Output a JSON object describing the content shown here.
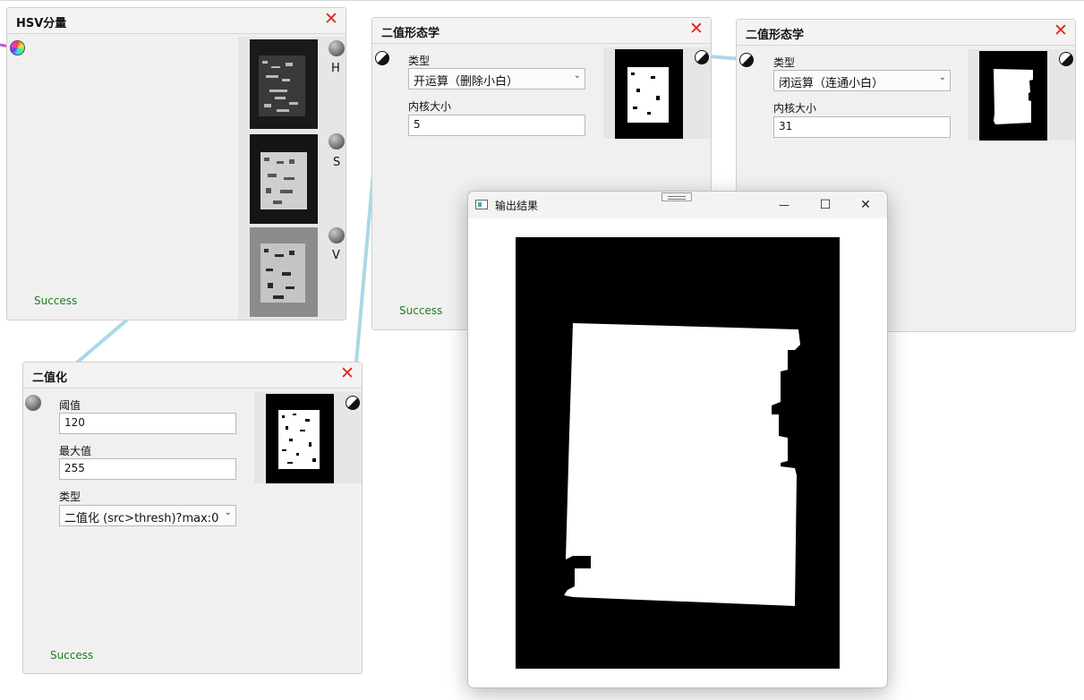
{
  "nodes": {
    "hsv": {
      "title": "HSV分量",
      "channels": [
        "H",
        "S",
        "V"
      ],
      "status": "Success"
    },
    "threshold": {
      "title": "二值化",
      "threshold_label": "阈值",
      "threshold_value": "120",
      "max_label": "最大值",
      "max_value": "255",
      "type_label": "类型",
      "type_value": "二值化 (src>thresh)?max:0",
      "status": "Success"
    },
    "morph_open": {
      "title": "二值形态学",
      "type_label": "类型",
      "type_value": "开运算（删除小白）",
      "kernel_label": "内核大小",
      "kernel_value": "5",
      "status": "Success"
    },
    "morph_close": {
      "title": "二值形态学",
      "type_label": "类型",
      "type_value": "闭运算（连通小白）",
      "kernel_label": "内核大小",
      "kernel_value": "31"
    }
  },
  "result_window": {
    "title": "输出结果",
    "minimize_glyph": "—",
    "maximize_glyph": "☐",
    "close_glyph": "✕"
  },
  "icons": {
    "close": "✕",
    "dropdown": "⌄"
  },
  "colors": {
    "close_red": "#e0251b",
    "success_green": "#1e7d1e",
    "link_blue": "#a9d8e6",
    "panel_bg": "#f0f0f0"
  }
}
